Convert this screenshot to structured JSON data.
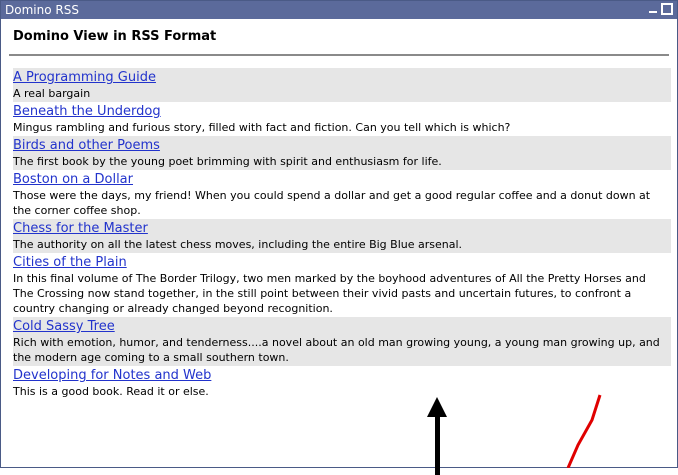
{
  "window": {
    "title": "Domino RSS"
  },
  "heading": "Domino View in RSS Format",
  "items": [
    {
      "title": "A Programming Guide",
      "description": "A real bargain"
    },
    {
      "title": "Beneath the Underdog",
      "description": "Mingus rambling and furious story, filled with fact and fiction. Can you tell which is which?"
    },
    {
      "title": "Birds and other Poems",
      "description": "The first book by the young poet brimming with spirit and enthusiasm for life."
    },
    {
      "title": "Boston on a Dollar",
      "description": "Those were the days, my friend! When you could spend a dollar and get a good regular coffee and a donut down at the corner coffee shop."
    },
    {
      "title": "Chess for the Master",
      "description": "The authority on all the latest chess moves, including the entire Big Blue arsenal."
    },
    {
      "title": "Cities of the Plain",
      "description": "In this final volume of The Border Trilogy, two men marked by the boyhood adventures of All the Pretty Horses and The Crossing now stand together, in the still point between their vivid pasts and uncertain futures, to confront a country changing or already changed beyond recognition."
    },
    {
      "title": "Cold Sassy Tree",
      "description": "Rich with emotion, humor, and tenderness....a novel about an old man growing young, a young man growing up, and the modern age coming to a small southern town."
    },
    {
      "title": "Developing for Notes and Web",
      "description": "This is a good book. Read it or else."
    }
  ],
  "colors": {
    "titlebar": "#5b6a9b",
    "link": "#2233cc",
    "row_alt": "#e6e6e6",
    "annotation_red": "#e00000"
  }
}
